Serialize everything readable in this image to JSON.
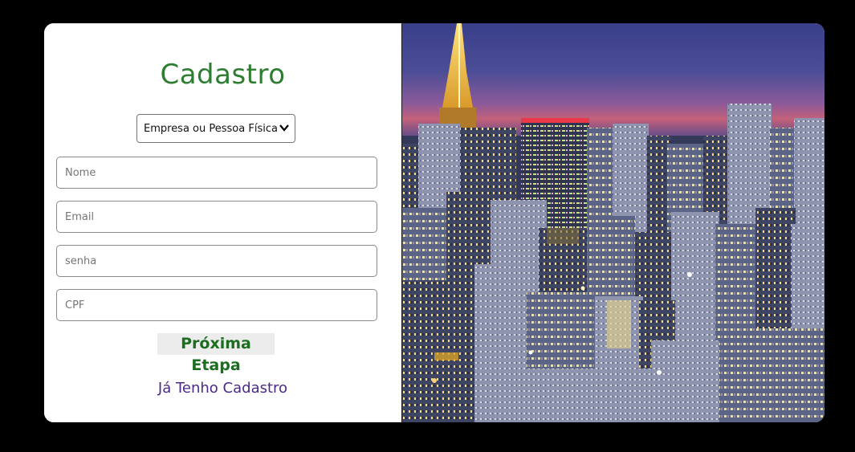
{
  "form": {
    "title": "Cadastro",
    "type_select": {
      "selected": "Empresa ou Pessoa Física"
    },
    "fields": {
      "name_placeholder": "Nome",
      "email_placeholder": "Email",
      "password_placeholder": "senha",
      "cpf_placeholder": "CPF"
    },
    "next_button_label": "Próxima Etapa",
    "login_link_label": "Já Tenho Cadastro"
  },
  "colors": {
    "background": "#000000",
    "card": "#ffffff",
    "title": "#2e7d32",
    "next_button_text": "#1b6e20",
    "link": "#4a2a86"
  },
  "image": {
    "subject": "night-city-skyline-photo"
  }
}
